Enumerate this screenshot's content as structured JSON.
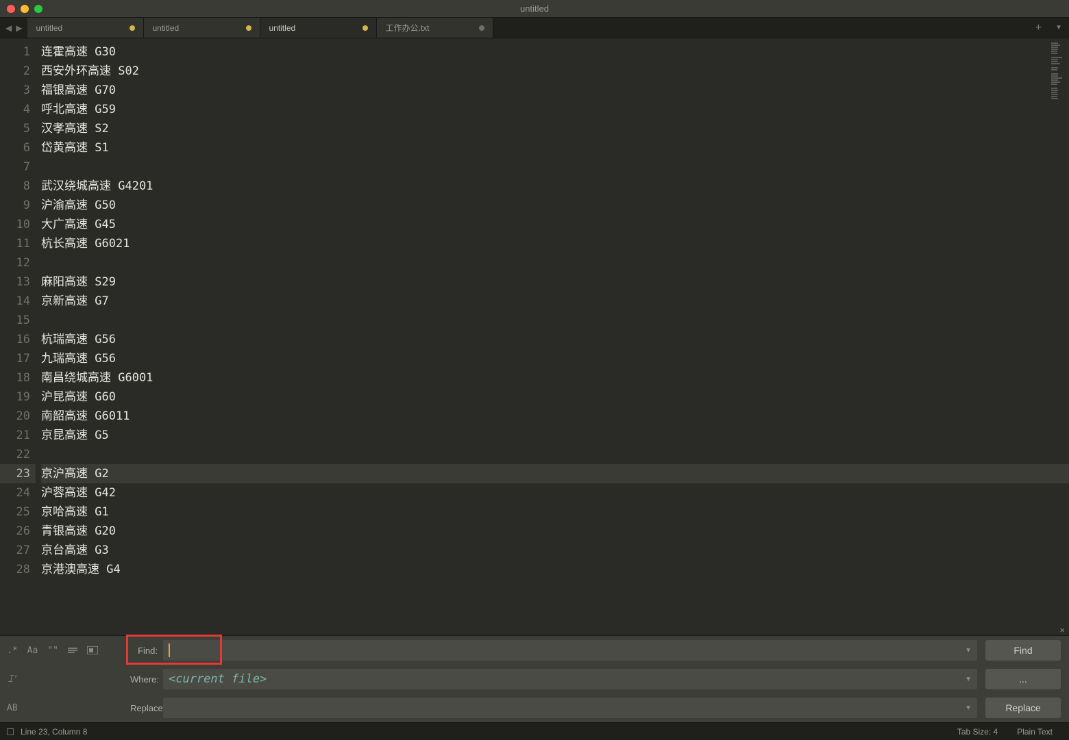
{
  "window": {
    "title": "untitled"
  },
  "tabs": [
    {
      "label": "untitled",
      "modified": true,
      "active": false
    },
    {
      "label": "untitled",
      "modified": true,
      "active": false
    },
    {
      "label": "untitled",
      "modified": true,
      "active": true
    },
    {
      "label": "工作办公.txt",
      "modified": false,
      "active": false
    }
  ],
  "editor": {
    "current_line": 23,
    "lines": [
      "连霍高速 G30",
      "西安外环高速 S02",
      "福银高速 G70",
      "呼北高速 G59",
      "汉孝高速 S2",
      "岱黄高速 S1",
      "",
      "武汉绕城高速 G4201",
      "沪渝高速 G50",
      "大广高速 G45",
      "杭长高速 G6021",
      "",
      "麻阳高速 S29",
      "京新高速 G7",
      "",
      "杭瑞高速 G56",
      "九瑞高速 G56",
      "南昌绕城高速 G6001",
      "沪昆高速 G60",
      "南韶高速 G6011",
      "京昆高速 G5",
      "",
      "京沪高速 G2",
      "沪蓉高速 G42",
      "京哈高速 G1",
      "青银高速 G20",
      "京台高速 G3",
      "京港澳高速 G4"
    ]
  },
  "search": {
    "find_label": "Find:",
    "where_label": "Where:",
    "replace_label": "Replace:",
    "find_value": "",
    "where_placeholder": "<current file>",
    "replace_value": "",
    "find_button": "Find",
    "where_button": "...",
    "replace_button": "Replace",
    "regex_opt": ".*",
    "case_opt": "Aa",
    "quote_opt": "\"\"",
    "preserve_opt": "AB"
  },
  "statusbar": {
    "position": "Line 23, Column 8",
    "tab_size": "Tab Size: 4",
    "syntax": "Plain Text"
  }
}
